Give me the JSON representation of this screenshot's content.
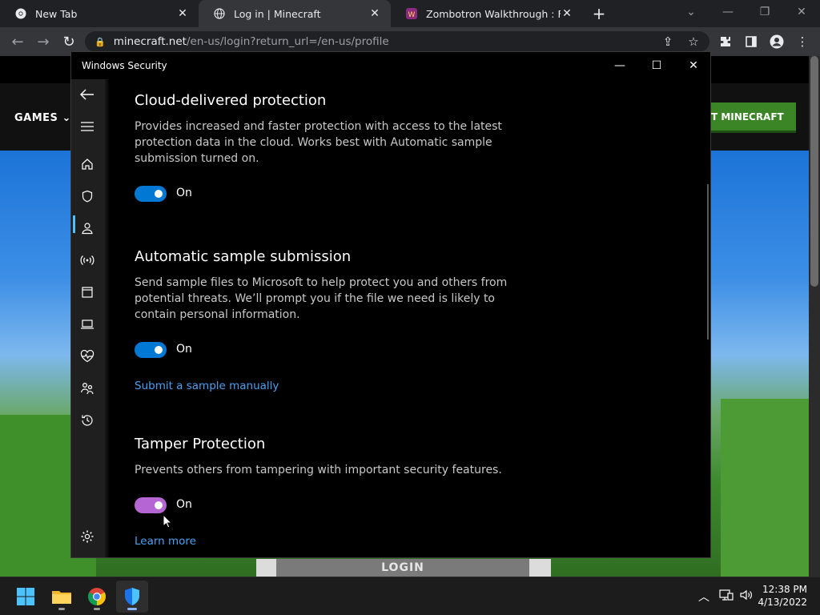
{
  "browser": {
    "tabs": [
      {
        "title": "New Tab",
        "icon": "chrome-icon",
        "active": false
      },
      {
        "title": "Log in | Minecraft",
        "icon": "globe-icon",
        "active": true
      },
      {
        "title": "Zombotron Walkthrough : Friv",
        "icon": "friv-icon",
        "active": false
      }
    ],
    "url_host": "minecraft.net",
    "url_path": "/en-us/login?return_url=/en-us/profile"
  },
  "minecraft": {
    "games_label": "GAMES",
    "get_button": "T MINECRAFT",
    "login_button": "LOGIN"
  },
  "windows_security": {
    "title": "Windows Security",
    "sections": [
      {
        "title": "Cloud-delivered protection",
        "description": "Provides increased and faster protection with access to the latest protection data in the cloud. Works best with Automatic sample submission turned on.",
        "toggle_label": "On",
        "toggle_on": true
      },
      {
        "title": "Automatic sample submission",
        "description": "Send sample files to Microsoft to help protect you and others from potential threats. We’ll prompt you if the file we need is likely to contain personal information.",
        "toggle_label": "On",
        "toggle_on": true,
        "link": "Submit a sample manually"
      },
      {
        "title": "Tamper Protection",
        "description": "Prevents others from tampering with important security features.",
        "toggle_label": "On",
        "toggle_on": true,
        "link": "Learn more"
      }
    ],
    "accent_color": "#0078d4",
    "tamper_toggle_color": "#b566d4"
  },
  "taskbar": {
    "time": "12:38 PM",
    "date": "4/13/2022"
  }
}
